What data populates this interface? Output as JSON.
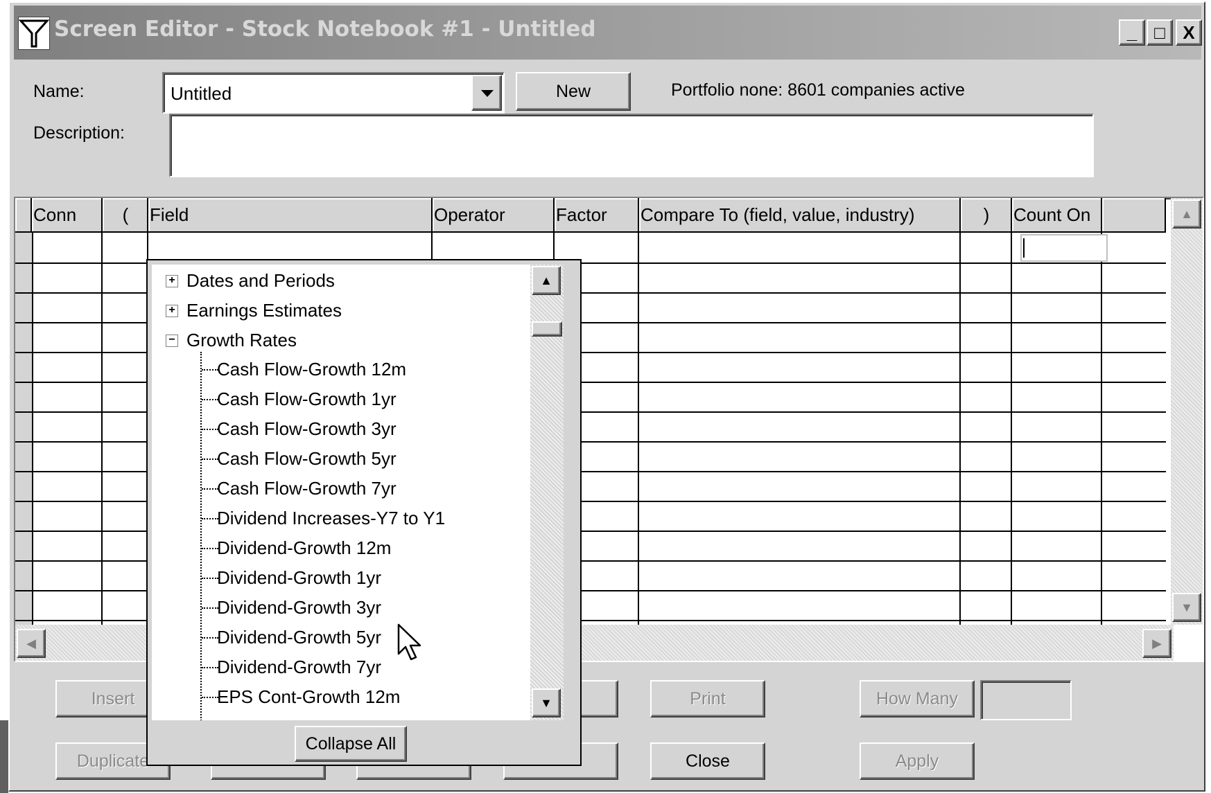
{
  "window": {
    "title": "Screen Editor - Stock Notebook #1 - Untitled",
    "controls": {
      "minimize": "_",
      "maximize": "□",
      "close": "X"
    }
  },
  "form": {
    "name_label": "Name:",
    "name_value": "Untitled",
    "new_button": "New",
    "status": "Portfolio none: 8601 companies active",
    "description_label": "Description:",
    "description_value": ""
  },
  "grid": {
    "columns": [
      "Conn",
      "(",
      "Field",
      "Operator",
      "Factor",
      "Compare To (field, value, industry)",
      ")",
      "Count On"
    ]
  },
  "tree": {
    "groups": [
      {
        "label": "Dates and Periods",
        "expanded": false,
        "expander": "+"
      },
      {
        "label": "Earnings Estimates",
        "expanded": false,
        "expander": "+"
      },
      {
        "label": "Growth Rates",
        "expanded": true,
        "expander": "−"
      }
    ],
    "items": [
      "Cash Flow-Growth 12m",
      "Cash Flow-Growth 1yr",
      "Cash Flow-Growth 3yr",
      "Cash Flow-Growth 5yr",
      "Cash Flow-Growth 7yr",
      "Dividend Increases-Y7 to Y1",
      "Dividend-Growth 12m",
      "Dividend-Growth 1yr",
      "Dividend-Growth 3yr",
      "Dividend-Growth 5yr",
      "Dividend-Growth 7yr",
      "EPS Cont-Growth 12m"
    ],
    "collapse_all": "Collapse All"
  },
  "buttons": {
    "insert": "Insert",
    "duplicate": "Duplicate",
    "print": "Print",
    "how_many": "How Many",
    "close": "Close",
    "apply": "Apply"
  }
}
